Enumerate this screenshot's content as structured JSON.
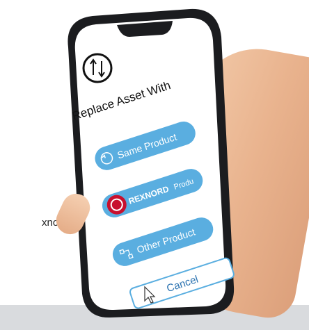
{
  "side_text": "xnord",
  "dialog": {
    "title": "Replace Asset With",
    "buttons": {
      "same": "Same Product",
      "rexnord_brand": "REXNORD",
      "rexnord_suffix": "Produ",
      "other": "Other Product",
      "cancel": "Cancel"
    }
  },
  "icons": {
    "swap": "swap-arrows-icon",
    "same": "cycle-icon",
    "rexnord": "rexnord-logo",
    "other": "flow-icon",
    "cursor": "cursor-arrow-icon"
  },
  "colors": {
    "button_blue": "#5aaee0",
    "rexnord_red": "#c8102e",
    "cancel_border": "#5aaee0",
    "phone_frame": "#1b1c1f"
  }
}
